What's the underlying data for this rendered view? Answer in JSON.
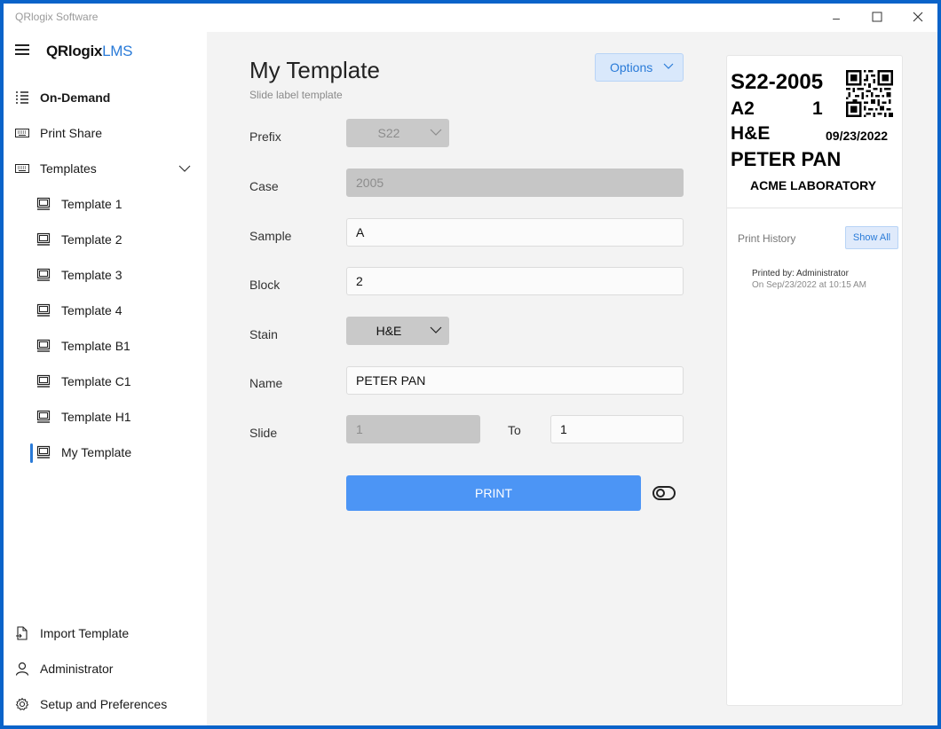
{
  "window": {
    "title": "QRlogix Software"
  },
  "sidebar": {
    "brand_main": "QRlogix",
    "brand_accent": "LMS",
    "items": [
      {
        "label": "On-Demand",
        "icon": "list-icon"
      },
      {
        "label": "Print Share",
        "icon": "keyboard-icon"
      },
      {
        "label": "Templates",
        "icon": "keyboard-icon",
        "expanded": true
      },
      {
        "label": "Template 1",
        "icon": "monitor-icon"
      },
      {
        "label": "Template 2",
        "icon": "monitor-icon"
      },
      {
        "label": "Template 3",
        "icon": "monitor-icon"
      },
      {
        "label": "Template 4",
        "icon": "monitor-icon"
      },
      {
        "label": "Template B1",
        "icon": "monitor-icon"
      },
      {
        "label": "Template C1",
        "icon": "monitor-icon"
      },
      {
        "label": "Template H1",
        "icon": "monitor-icon"
      },
      {
        "label": "My Template",
        "icon": "monitor-icon",
        "selected": true
      }
    ],
    "footer": [
      {
        "label": "Import Template",
        "icon": "import-file-icon"
      },
      {
        "label": "Administrator",
        "icon": "user-icon"
      },
      {
        "label": "Setup and Preferences",
        "icon": "gear-icon"
      }
    ]
  },
  "main": {
    "title": "My Template",
    "subtitle": "Slide label template",
    "options_label": "Options",
    "fields": {
      "prefix": {
        "label": "Prefix",
        "value": "S22"
      },
      "case": {
        "label": "Case",
        "value": "2005"
      },
      "sample": {
        "label": "Sample",
        "value": "A"
      },
      "block": {
        "label": "Block",
        "value": "2"
      },
      "stain": {
        "label": "Stain",
        "value": "H&E"
      },
      "name": {
        "label": "Name",
        "value": "PETER PAN"
      },
      "slide": {
        "label": "Slide",
        "value": "1"
      },
      "to": {
        "label": "To",
        "value": "1"
      }
    },
    "print_label": "PRINT"
  },
  "preview": {
    "code": "S22-2005",
    "sample": "A2",
    "block_count": "1",
    "stain": "H&E",
    "date": "09/23/2022",
    "name": "PETER PAN",
    "lab": "ACME LABORATORY"
  },
  "history": {
    "title": "Print History",
    "show_all": "Show All",
    "entries": [
      {
        "by": "Printed by: Administrator",
        "on": "On Sep/23/2022 at 10:15 AM"
      }
    ]
  },
  "colors": {
    "accent": "#2a7bd8",
    "print_button": "#4c95f5",
    "frame": "#0a63c9"
  }
}
